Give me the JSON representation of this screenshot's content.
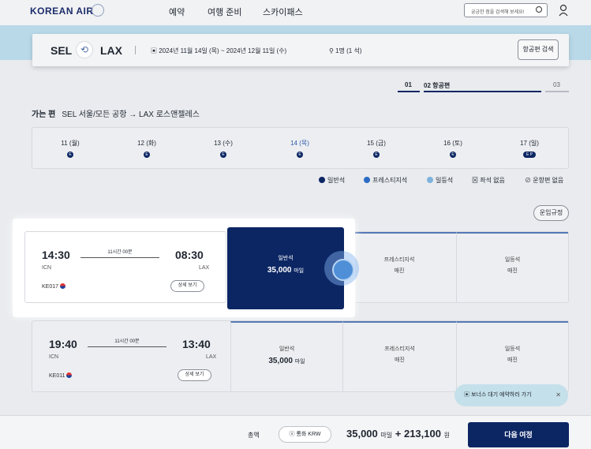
{
  "header": {
    "logo": "KOREAN AIR",
    "nav": [
      "예약",
      "여행 준비",
      "스카이패스"
    ],
    "search_placeholder": "궁금한 점을 검색해 보세요!"
  },
  "search_bar": {
    "origin": "SEL",
    "destination": "LAX",
    "dates": "2024년 11월 14일 (목) ~ 2024년 12월 11일 (수)",
    "passengers": "1명 (1 석)",
    "search_button": "항공편 검색"
  },
  "steps": {
    "s1": "01",
    "s2": "02 항공편",
    "s3": "03"
  },
  "route": {
    "label": "가는 편",
    "text": "SEL 서울/모든 공항 → LAX 로스앤젤레스"
  },
  "dates": [
    {
      "label": "11 (월)",
      "badge": "E"
    },
    {
      "label": "12 (화)",
      "badge": "E"
    },
    {
      "label": "13 (수)",
      "badge": "E"
    },
    {
      "label": "14 (목)",
      "badge": "E"
    },
    {
      "label": "15 (금)",
      "badge": "E"
    },
    {
      "label": "16 (토)",
      "badge": "E"
    },
    {
      "label": "17 (일)",
      "badge": "E P"
    }
  ],
  "legend": {
    "economy": "일반석",
    "prestige": "프레스티지석",
    "first": "일등석",
    "no_seat": "좌석 없음",
    "no_flight": "운항편 없음"
  },
  "rules_button": "운임규정",
  "flights": [
    {
      "dep_time": "14:30",
      "arr_time": "08:30",
      "dep_code": "ICN",
      "arr_code": "LAX",
      "duration": "11시간 00분",
      "flight_no": "KE017",
      "detail": "상세 보기",
      "economy_label": "일반석",
      "economy_price": "35,000",
      "prestige_label": "프레스티지석",
      "prestige_status": "매진",
      "first_label": "일등석",
      "first_status": "매진"
    },
    {
      "dep_time": "19:40",
      "arr_time": "13:40",
      "dep_code": "ICN",
      "arr_code": "LAX",
      "duration": "11시간 00분",
      "flight_no": "KE011",
      "detail": "상세 보기",
      "economy_label": "일반석",
      "economy_price": "35,000",
      "prestige_label": "프레스티지석",
      "prestige_status": "매진",
      "first_label": "일등석",
      "first_status": "매진"
    }
  ],
  "mile_unit": "마일",
  "toast": "보너스 대기 예약하러 가기",
  "footer": {
    "total": "총액",
    "currency": "통화 KRW",
    "miles": "35,000",
    "mile_unit": "마일",
    "plus": "+",
    "won": "213,100",
    "won_unit": "원",
    "next": "다음 여정"
  }
}
